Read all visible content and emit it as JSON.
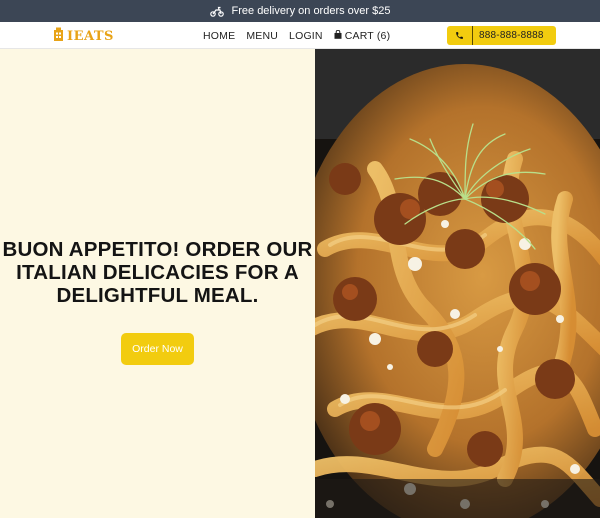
{
  "banner": {
    "icon": "scooter-icon",
    "text": "Free delivery on orders over $25"
  },
  "header": {
    "logo_text": "Ieats",
    "logo_icon": "building-icon",
    "nav": {
      "home": "HOME",
      "menu": "MENU",
      "login": "LOGIN",
      "cart": "CART (6)"
    },
    "phone": {
      "icon": "phone-icon",
      "number": "888-888-8888"
    }
  },
  "hero": {
    "headline": "BUON APPETITO! ORDER OUR ITALIAN DELICACIES FOR A DELIGHTFUL MEAL.",
    "cta_label": "Order Now",
    "image_alt": "pasta-dish-photo"
  },
  "colors": {
    "banner_bg": "#3c4655",
    "accent": "#f2cc0f",
    "logo": "#e8a317",
    "hero_bg": "#fdf8e3"
  }
}
